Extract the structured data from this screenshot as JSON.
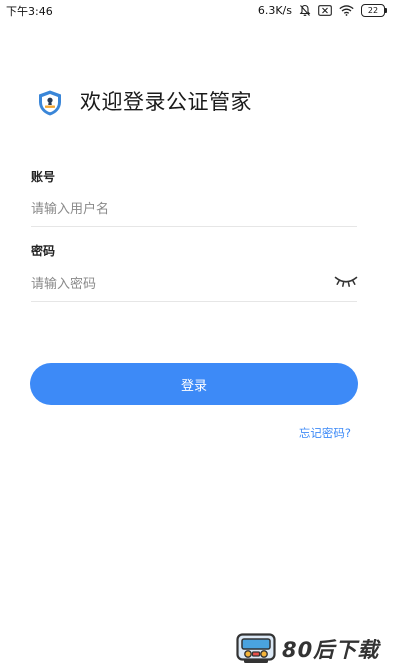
{
  "status_bar": {
    "time": "下午3:46",
    "network_speed": "6.3K/s",
    "battery": "22",
    "icons": [
      "notification-off-icon",
      "sim-off-icon",
      "wifi-icon",
      "battery-icon"
    ]
  },
  "header": {
    "title": "欢迎登录公证管家",
    "logo_icon": "shield-notary-icon"
  },
  "form": {
    "account": {
      "label": "账号",
      "placeholder": "请输入用户名",
      "value": ""
    },
    "password": {
      "label": "密码",
      "placeholder": "请输入密码",
      "value": "",
      "toggle_icon": "eye-closed-icon"
    }
  },
  "actions": {
    "login_label": "登录",
    "forgot_label": "忘记密码?"
  },
  "watermark": {
    "text": "80后下载"
  },
  "colors": {
    "accent": "#3d8af7",
    "text": "#1a1a1a",
    "placeholder": "#8a8a8a",
    "divider": "#e6e6e6",
    "logo_blue": "#3a86d8"
  }
}
